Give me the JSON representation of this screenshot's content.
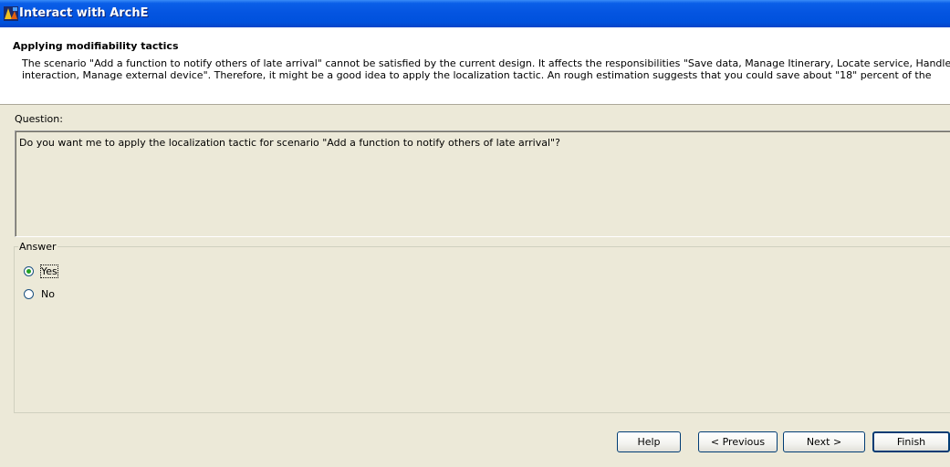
{
  "window": {
    "title": "Interact with ArchE",
    "icon": "arche-app-icon"
  },
  "header": {
    "title": "Applying modifiability tactics",
    "description_lines": [
      "The scenario \"Add a function to notify others of late arrival\" cannot be satisfied by the current design. It affects the responsibilities \"Save data, Manage Itinerary, Locate service, Handle us",
      "interaction, Manage external device\". Therefore, it might be a good idea to apply the localization tactic. An rough estimation suggests that you could save about \"18\" percent of the"
    ]
  },
  "question": {
    "label": "Question:",
    "text": "Do you want me to apply the localization tactic for scenario \"Add a function to notify others of late arrival\"?"
  },
  "answer": {
    "legend": "Answer",
    "options": [
      {
        "label": "Yes",
        "selected": true
      },
      {
        "label": "No",
        "selected": false
      }
    ]
  },
  "buttons": {
    "help": "Help",
    "previous": "< Previous",
    "next": "Next >",
    "finish": "Finish"
  }
}
